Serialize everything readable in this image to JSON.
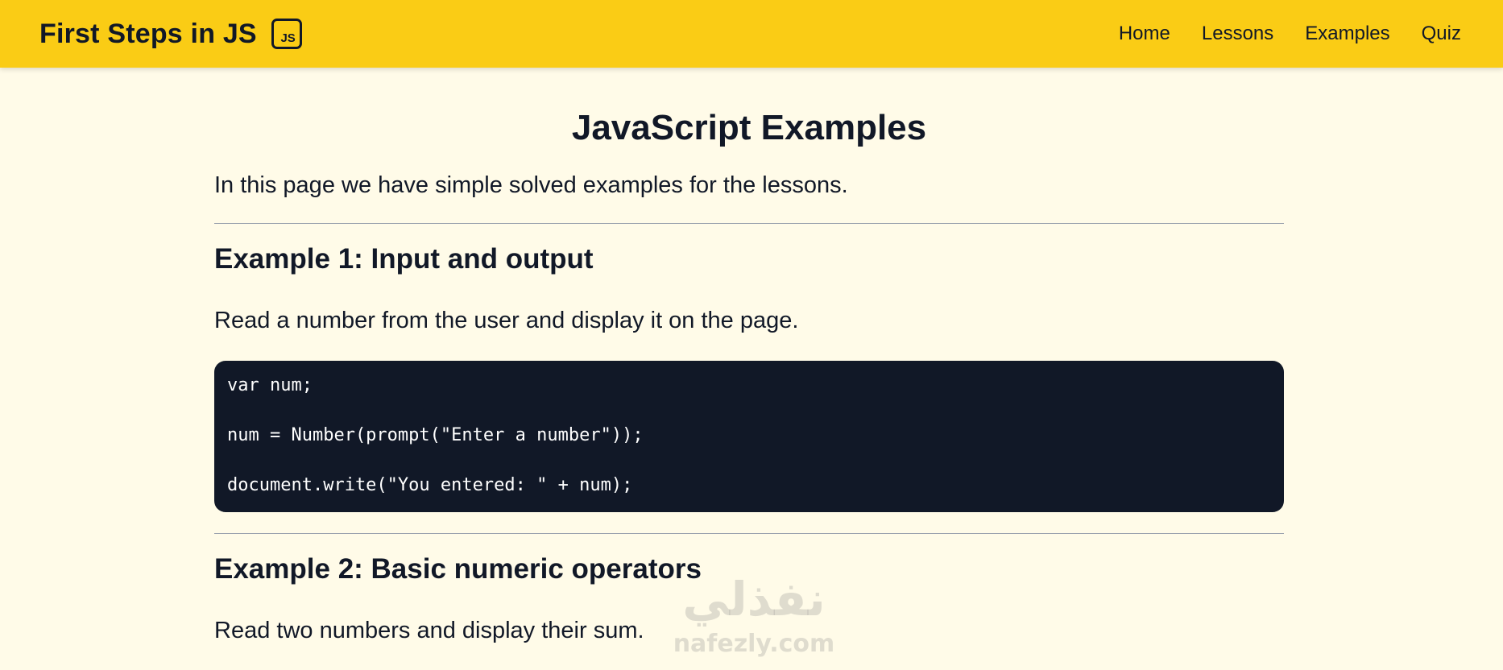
{
  "header": {
    "brand": "First Steps in JS",
    "badge": "JS",
    "nav": [
      {
        "label": "Home"
      },
      {
        "label": "Lessons"
      },
      {
        "label": "Examples"
      },
      {
        "label": "Quiz"
      }
    ]
  },
  "page": {
    "title": "JavaScript Examples",
    "intro": "In this page we have simple solved examples for the lessons."
  },
  "examples": [
    {
      "title": "Example 1: Input and output",
      "description": "Read a number from the user and display it on the page.",
      "code": [
        "var num;",
        "num = Number(prompt(\"Enter a number\"));",
        "document.write(\"You entered: \" + num);"
      ]
    },
    {
      "title": "Example 2: Basic numeric operators",
      "description": "Read two numbers and display their sum."
    }
  ],
  "watermark": {
    "arabic": "نفذلي",
    "latin": "nafezly.com"
  },
  "colors": {
    "header_bg": "#facc15",
    "page_bg": "#fffbe8",
    "code_bg": "#111827",
    "text": "#111827"
  }
}
